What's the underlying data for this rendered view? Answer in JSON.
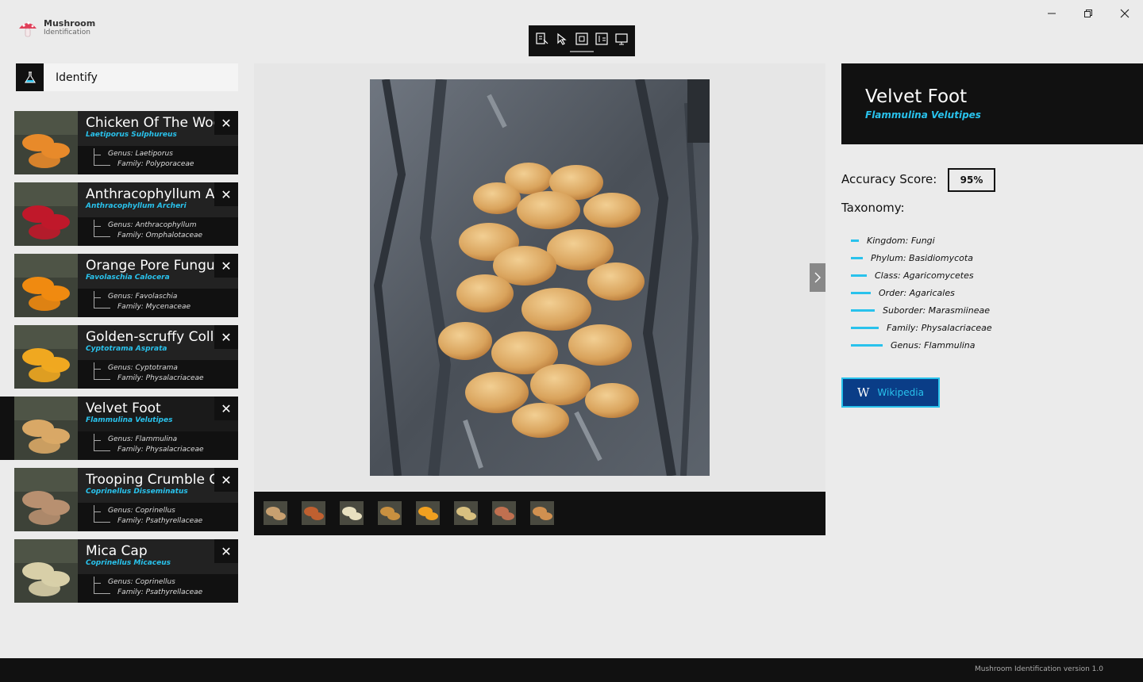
{
  "app": {
    "name_line1": "Mushroom",
    "name_line2": "Identification",
    "version": "Mushroom Identification version 1.0"
  },
  "window_controls": [
    "minimize",
    "restore",
    "close"
  ],
  "toolbar": {
    "icons": [
      "select-tool-icon",
      "pointer-tool-icon",
      "frame-tool-icon",
      "inspect-tool-icon",
      "screen-tool-icon"
    ]
  },
  "identify": {
    "label": "Identify"
  },
  "mushrooms": [
    {
      "common": "Chicken Of The Woods",
      "scientific": "Laetiporus Sulphureus",
      "genus": "Genus:  Laetiporus",
      "family": "Family:  Polyporaceae",
      "color": "#e88a2a"
    },
    {
      "common": "Anthracophyllum Archeri",
      "scientific": "Anthracophyllum Archeri",
      "genus": "Genus:  Anthracophyllum",
      "family": "Family:  Omphalotaceae",
      "color": "#c0182a"
    },
    {
      "common": "Orange Pore Fungus",
      "scientific": "Favolaschia Calocera",
      "genus": "Genus:  Favolaschia",
      "family": "Family:  Mycenaceae",
      "color": "#f08a10"
    },
    {
      "common": "Golden-scruffy Collybia",
      "scientific": "Cyptotrama Asprata",
      "genus": "Genus:  Cyptotrama",
      "family": "Family:  Physalacriaceae",
      "color": "#f0a820"
    },
    {
      "common": "Velvet Foot",
      "scientific": "Flammulina Velutipes",
      "genus": "Genus:  Flammulina",
      "family": "Family:  Physalacriaceae",
      "color": "#d9a866"
    },
    {
      "common": "Trooping Crumble Cap",
      "scientific": "Coprinellus Disseminatus",
      "genus": "Genus:  Coprinellus",
      "family": "Family:  Psathyrellaceae",
      "color": "#b89070"
    },
    {
      "common": "Mica Cap",
      "scientific": "Coprinellus Micaceus",
      "genus": "Genus:  Coprinellus",
      "family": "Family:  Psathyrellaceae",
      "color": "#d8cfa8"
    }
  ],
  "selected_index": 4,
  "viewer": {
    "thumbnails": [
      "#c8a070",
      "#c06030",
      "#e8e0c0",
      "#c89040",
      "#f0a020",
      "#d8c080",
      "#c07050",
      "#d09050"
    ]
  },
  "detail": {
    "common": "Velvet Foot",
    "scientific": "Flammulina Velutipes",
    "accuracy_label": "Accuracy Score:",
    "accuracy_value": "95%",
    "taxonomy_label": "Taxonomy:",
    "taxonomy": [
      "Kingdom: Fungi",
      "Phylum: Basidiomycota",
      "Class: Agaricomycetes",
      "Order: Agaricales",
      "Suborder: Marasmiineae",
      "Family: Physalacriaceae",
      "Genus: Flammulina"
    ],
    "wiki_label": "Wikipedia"
  },
  "colors": {
    "accent": "#29c2ec",
    "dark": "#111111",
    "wiki_bg": "#0a3d87"
  }
}
